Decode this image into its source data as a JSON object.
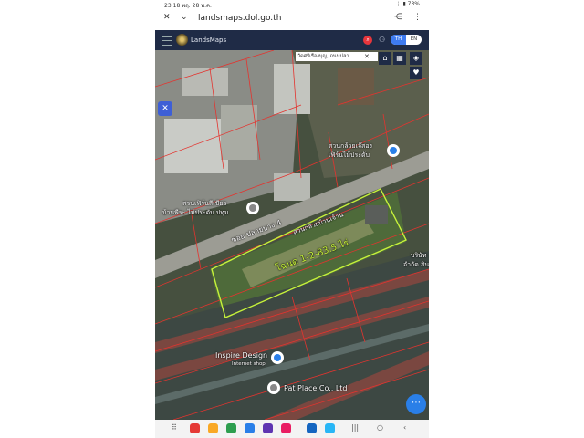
{
  "status": {
    "time": "23:18",
    "date": "พฤ. 28 พ.ค.",
    "battery": "73%"
  },
  "browser": {
    "url": "landsmaps.dol.go.th"
  },
  "app": {
    "name": "LandsMaps",
    "lang_th": "TH",
    "lang_en": "EN"
  },
  "map": {
    "search_text": "วัดศรีเรืองบุญ, ถนนปลา",
    "parcel_label": "โฉนด 1-2-83.5 ไร่",
    "road_label": "ซอย ปลายบาง 4",
    "places": [
      {
        "name": "สวนกล้วยเจ๊สอง"
      },
      {
        "name": "เฟิร์นไม้ประดับ"
      },
      {
        "name": "สวนเฟิร์นสีเขียว"
      },
      {
        "name": "บ้านพีระ ไม้ประดับ ปทุม"
      },
      {
        "name": "สวนกล้วยบ้านเจ้าน"
      },
      {
        "name": "บริษัท"
      },
      {
        "name": "จำกัด สินค้า"
      },
      {
        "name": "Inspire Design"
      },
      {
        "name": "Internet shop"
      },
      {
        "name": "Pat Place Co., Ltd"
      }
    ]
  },
  "colors": {
    "header_bg": "#1f2b46",
    "parcel_outline": "#c6f23a",
    "parcel_lines": "#e3342f",
    "accent": "#3e7bf1"
  }
}
